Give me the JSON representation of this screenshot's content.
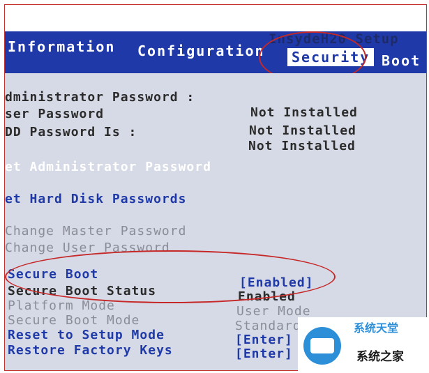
{
  "app": {
    "brand": "InsydeH20 Setup"
  },
  "tabs": [
    {
      "label": "Information"
    },
    {
      "label": "Configuration"
    },
    {
      "label": "Security"
    },
    {
      "label": "Boot"
    }
  ],
  "passwords": {
    "admin_label": "dministrator Password :",
    "admin_value": "Not Installed",
    "user_label": "ser Password",
    "user_value": "Not Installed",
    "hdd_label": "DD Password Is :",
    "hdd_value": "Not Installed"
  },
  "actions": {
    "set_admin": "et Administrator Password",
    "set_hdd": "et Hard Disk Passwords",
    "change_master": "Change Master Password",
    "change_user": "Change User Password"
  },
  "secure_boot": {
    "secure_boot_label": "Secure Boot",
    "secure_boot_value": "[Enabled]",
    "status_label": "Secure Boot Status",
    "status_value": "Enabled",
    "platform_label": "Platform Mode",
    "platform_value": "User Mode",
    "mode_label": "Secure Boot Mode",
    "mode_value": "Standard",
    "reset_label": "Reset to Setup Mode",
    "reset_value": "[Enter]",
    "restore_label": "Restore Factory Keys",
    "restore_value": "[Enter]"
  },
  "watermark": {
    "name": "系统之家",
    "top": "系统天堂",
    "color": "#2e8fd9"
  },
  "colors": {
    "menu_bg": "#1f3aa8",
    "highlight_circle": "#c62828"
  }
}
